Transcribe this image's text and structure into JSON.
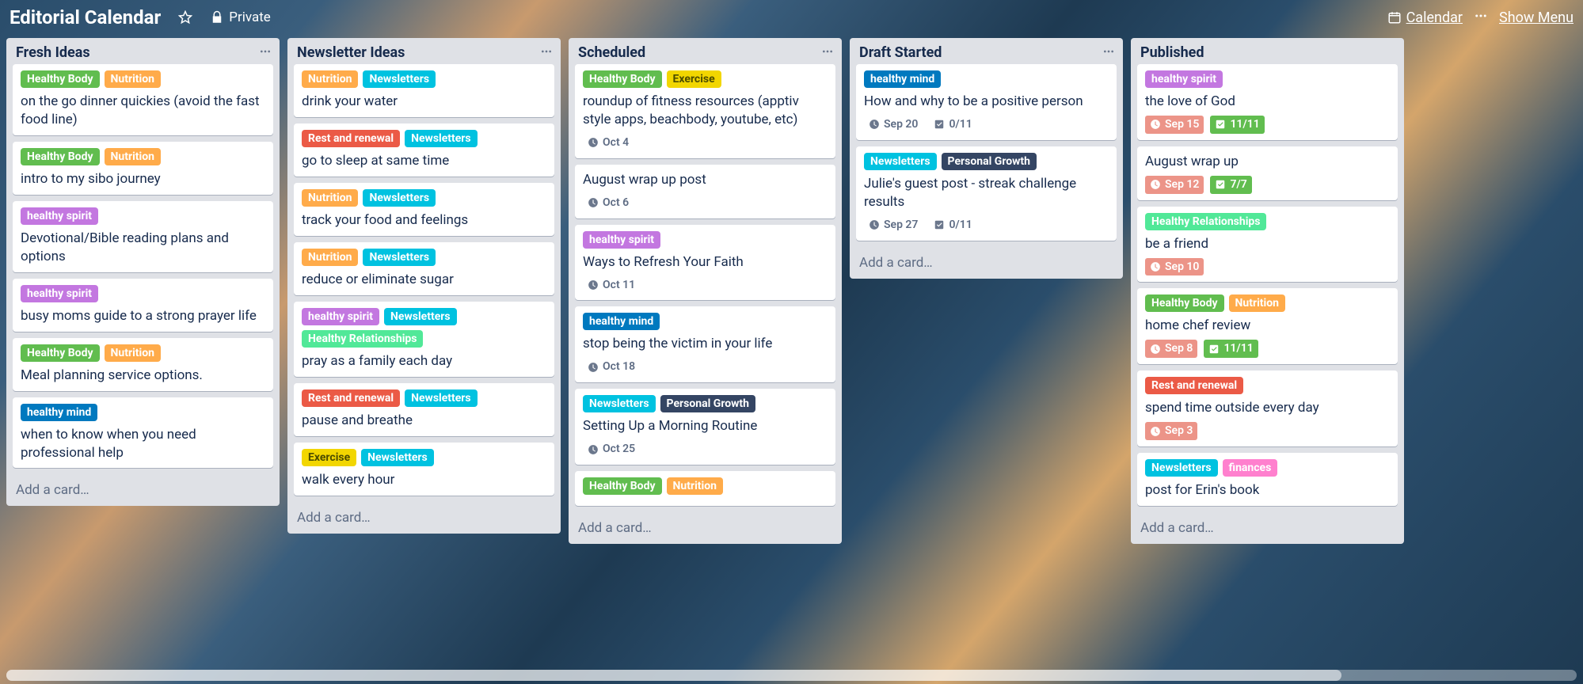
{
  "header": {
    "title": "Editorial Calendar",
    "privacy": "Private",
    "calendar_link": "Calendar",
    "show_menu": "Show Menu"
  },
  "label_colors": {
    "Healthy Body": "#61bd4f",
    "Nutrition": "#ffab4a",
    "healthy spirit": "#c377e0",
    "healthy mind": "#0079bf",
    "Rest and renewal": "#eb5a46",
    "Newsletters": "#00c2e0",
    "Healthy Relationships": "#51e898",
    "Exercise": "#f2d600",
    "Personal Growth": "#344563",
    "finances": "#ff80ce"
  },
  "add_card_text": "Add a card…",
  "lists": [
    {
      "title": "Fresh Ideas",
      "show_menu": true,
      "cards": [
        {
          "labels": [
            "Healthy Body",
            "Nutrition"
          ],
          "title": "on the go dinner quickies (avoid the fast food line)"
        },
        {
          "labels": [
            "Healthy Body",
            "Nutrition"
          ],
          "title": "intro to my sibo journey"
        },
        {
          "labels": [
            "healthy spirit"
          ],
          "title": "Devotional/Bible reading plans and options"
        },
        {
          "labels": [
            "healthy spirit"
          ],
          "title": "busy moms guide to a strong prayer life"
        },
        {
          "labels": [
            "Healthy Body",
            "Nutrition"
          ],
          "title": "Meal planning service options."
        },
        {
          "labels": [
            "healthy mind"
          ],
          "title": "when to know when you need professional help"
        }
      ]
    },
    {
      "title": "Newsletter Ideas",
      "show_menu": true,
      "cards": [
        {
          "labels": [
            "Nutrition",
            "Newsletters"
          ],
          "title": "drink your water"
        },
        {
          "labels": [
            "Rest and renewal",
            "Newsletters"
          ],
          "title": "go to sleep at same time"
        },
        {
          "labels": [
            "Nutrition",
            "Newsletters"
          ],
          "title": "track your food and feelings"
        },
        {
          "labels": [
            "Nutrition",
            "Newsletters"
          ],
          "title": "reduce or eliminate sugar"
        },
        {
          "labels": [
            "healthy spirit",
            "Newsletters",
            "Healthy Relationships"
          ],
          "title": "pray as a family each day"
        },
        {
          "labels": [
            "Rest and renewal",
            "Newsletters"
          ],
          "title": "pause and breathe"
        },
        {
          "labels": [
            "Exercise",
            "Newsletters"
          ],
          "title": "walk every hour"
        }
      ]
    },
    {
      "title": "Scheduled",
      "show_menu": true,
      "cards": [
        {
          "labels": [
            "Healthy Body",
            "Exercise"
          ],
          "title": "roundup of fitness resources (apptiv style apps, beachbody, youtube, etc)",
          "due": "Oct 4"
        },
        {
          "labels": [],
          "title": "August wrap up post",
          "due": "Oct 6"
        },
        {
          "labels": [
            "healthy spirit"
          ],
          "title": "Ways to Refresh Your Faith",
          "due": "Oct 11"
        },
        {
          "labels": [
            "healthy mind"
          ],
          "title": "stop being the victim in your life",
          "due": "Oct 18"
        },
        {
          "labels": [
            "Newsletters",
            "Personal Growth"
          ],
          "title": "Setting Up a Morning Routine",
          "due": "Oct 25"
        },
        {
          "labels": [
            "Healthy Body",
            "Nutrition"
          ],
          "title": ""
        }
      ]
    },
    {
      "title": "Draft Started",
      "show_menu": true,
      "cards": [
        {
          "labels": [
            "healthy mind"
          ],
          "title": "How and why to be a positive person",
          "due": "Sep 20",
          "checklist": "0/11"
        },
        {
          "labels": [
            "Newsletters",
            "Personal Growth"
          ],
          "title": "Julie's guest post - streak challenge results",
          "due": "Sep 27",
          "checklist": "0/11"
        }
      ]
    },
    {
      "title": "Published",
      "show_menu": false,
      "cards": [
        {
          "labels": [
            "healthy spirit"
          ],
          "title": "the love of God",
          "due": "Sep 15",
          "due_style": "red",
          "checklist": "11/11",
          "checklist_style": "green"
        },
        {
          "labels": [],
          "title": "August wrap up",
          "due": "Sep 12",
          "due_style": "red",
          "checklist": "7/7",
          "checklist_style": "green"
        },
        {
          "labels": [
            "Healthy Relationships"
          ],
          "title": "be a friend",
          "due": "Sep 10",
          "due_style": "red"
        },
        {
          "labels": [
            "Healthy Body",
            "Nutrition"
          ],
          "title": "home chef review",
          "due": "Sep 8",
          "due_style": "red",
          "checklist": "11/11",
          "checklist_style": "green"
        },
        {
          "labels": [
            "Rest and renewal"
          ],
          "title": "spend time outside every day",
          "due": "Sep 3",
          "due_style": "red"
        },
        {
          "labels": [
            "Newsletters",
            "finances"
          ],
          "title": "post for Erin's book"
        }
      ]
    }
  ]
}
